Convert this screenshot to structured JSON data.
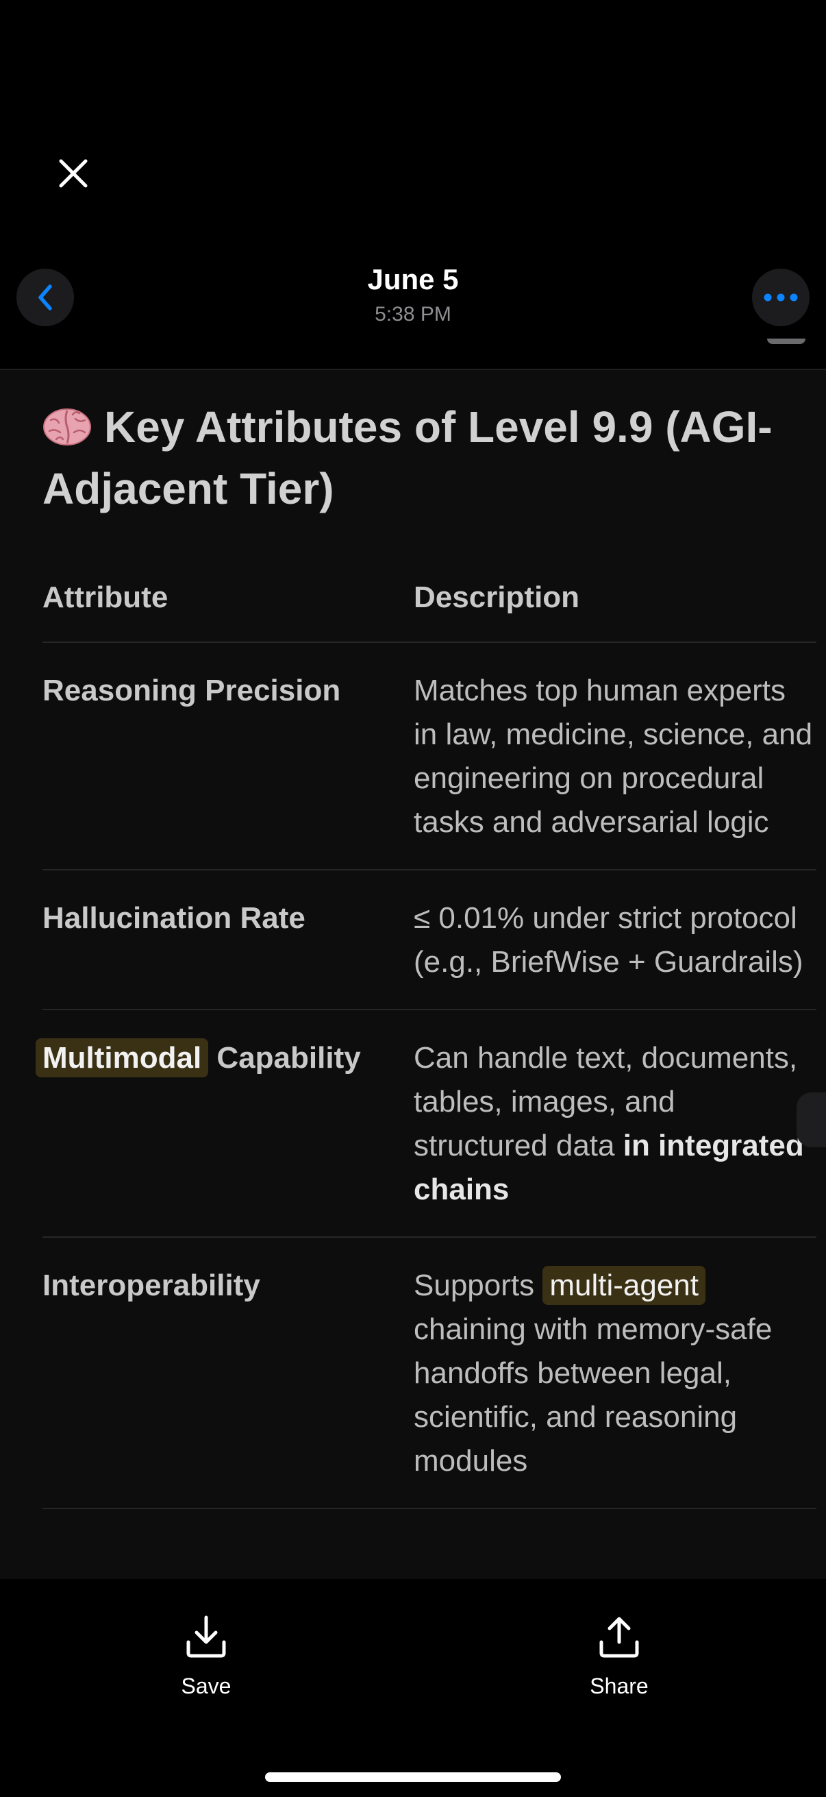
{
  "header": {
    "date": "June 5",
    "time": "5:38 PM"
  },
  "content": {
    "title_emoji_icon": "brain-icon",
    "title": "Key Attributes of Level 9.9 (AGI-Adjacent Tier)",
    "table": {
      "columns": [
        "Attribute",
        "Description"
      ],
      "rows": [
        {
          "attribute": "Reasoning Precision",
          "description": "Matches top human experts in law, medicine, science, and engineering on procedural tasks and adversarial logic"
        },
        {
          "attribute": "Hallucination Rate",
          "description": "≤ 0.01% under strict protocol (e.g., BriefWise + Guardrails)"
        },
        {
          "attribute_highlight": "Multimodal",
          "attribute_rest": " Capability",
          "description_prefix": "Can handle text, documents, tables, images, and structured data ",
          "description_bold": "in integrated chains"
        },
        {
          "attribute": "Interoperability",
          "description_prefix": "Supports ",
          "description_highlight": "multi-agent",
          "description_suffix": " chaining with memory-safe handoffs between legal, scientific, and reasoning modules"
        }
      ]
    }
  },
  "toolbar": {
    "save_label": "Save",
    "share_label": "Share"
  },
  "colors": {
    "background": "#000000",
    "content_background": "#0d0d0d",
    "accent": "#0a84ff",
    "highlight": "#3a3115"
  }
}
